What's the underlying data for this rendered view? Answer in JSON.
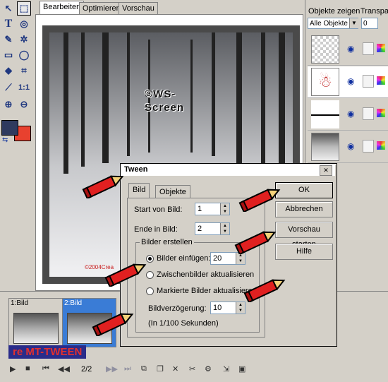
{
  "doc_tabs": [
    "Bearbeiten",
    "Optimieren",
    "Vorschau"
  ],
  "tools": [
    "T",
    "1:1"
  ],
  "layers": {
    "label": "Objekte zeigen",
    "transp_label": "Transpar",
    "select_value": "Alle Objekte",
    "transp_value": "0"
  },
  "watermark": "©WS-\nScreen",
  "copyright": "©2004Crea",
  "frames": [
    {
      "label": "1:Bild"
    },
    {
      "label": "2:Bild"
    }
  ],
  "tween_caption": "re MT-TWEEN",
  "frame_count": "2/2",
  "dialog": {
    "title": "Tween",
    "tabs": [
      "Bild",
      "Objekte"
    ],
    "start_label": "Start von Bild:",
    "start_value": "1",
    "end_label": "Ende in Bild:",
    "end_value": "2",
    "group_title": "Bilder erstellen",
    "insert_label": "Bilder einfügen:",
    "insert_value": "20",
    "radio_update": "Zwischenbilder aktualisieren",
    "radio_marked": "Markierte Bilder aktualisieren",
    "delay_label": "Bildverzögerung:",
    "delay_value": "10",
    "delay_unit": "(In 1/100 Sekunden)",
    "ok": "OK",
    "cancel": "Abbrechen",
    "preview": "Vorschau starten",
    "help": "Hilfe"
  },
  "colors": {
    "fg": "#2f3a5e",
    "bg": "#e8412f",
    "frame_selected": "#3a7cd6",
    "pencil": "#e02020"
  }
}
